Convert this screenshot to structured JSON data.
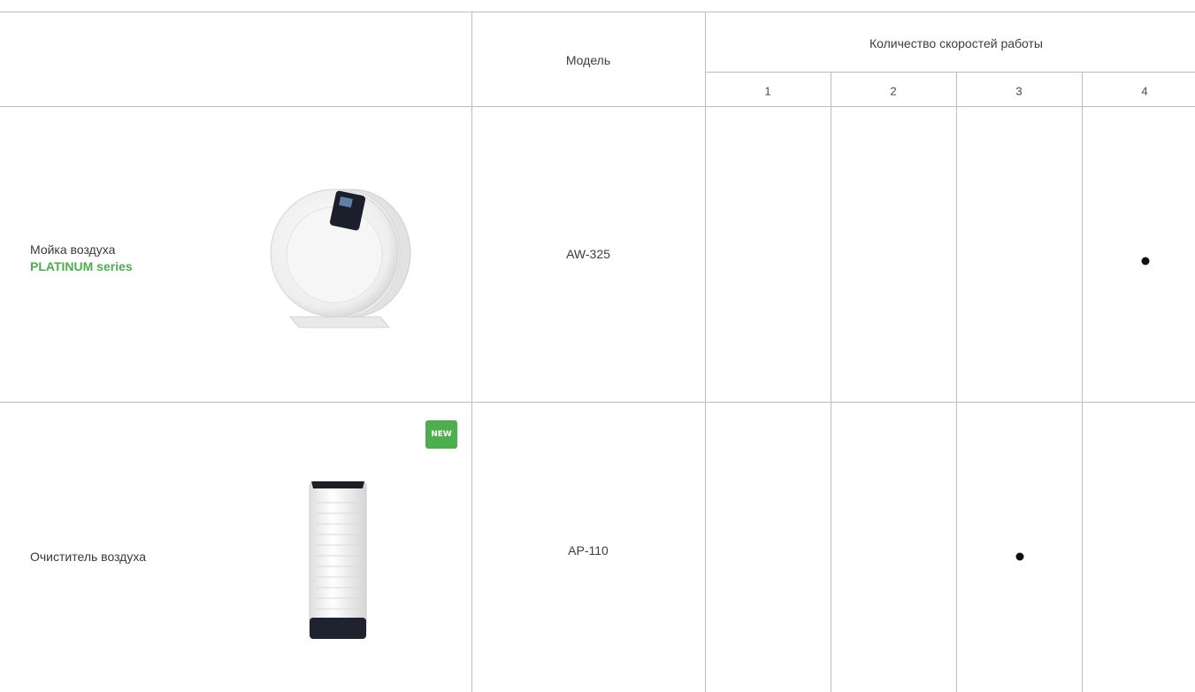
{
  "header": {
    "model_label": "Модель",
    "speeds_label": "Количество скоростей работы",
    "speed_columns": [
      "1",
      "2",
      "3",
      "4"
    ]
  },
  "rows": [
    {
      "product_line1": "Мойка воздуха",
      "product_series": "PLATINUM series",
      "model": "AW-325",
      "image": "round-air-washer-image",
      "speed_marked": 4,
      "badge": ""
    },
    {
      "product_line1": "Очиститель воздуха",
      "product_series": "",
      "model": "AP-110",
      "image": "tower-air-purifier-image",
      "speed_marked": 3,
      "badge": "NEW"
    }
  ],
  "colors": {
    "accent_green": "#4cae4c",
    "grid_line": "#bdbdbd",
    "dot": "#111111"
  }
}
